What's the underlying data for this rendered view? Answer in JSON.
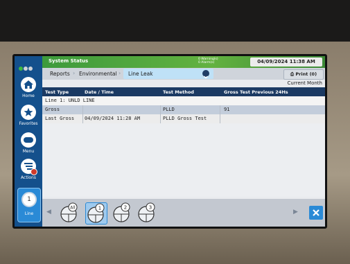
{
  "status_bar": {
    "title": "System Status",
    "warnings": "0 Warning(s)",
    "alarms": "0 Alarm(s)",
    "datetime": "04/09/2024 11:38 AM",
    "led_colors": [
      "#3fb83f",
      "#cfd3d8",
      "#cfd3d8"
    ]
  },
  "sidebar": {
    "items": [
      {
        "label": "Home",
        "icon": "home-icon"
      },
      {
        "label": "Favorites",
        "icon": "star-icon"
      },
      {
        "label": "Menu",
        "icon": "menu-icon"
      },
      {
        "label": "Actions",
        "icon": "actions-icon"
      }
    ],
    "tank_button": {
      "number": "1",
      "label": "Line"
    }
  },
  "breadcrumb": {
    "items": [
      "Reports",
      "Environmental",
      "Line Leak"
    ],
    "print_label": "Print (0)"
  },
  "period": "Current Month",
  "table": {
    "columns": [
      "Test Type",
      "Date / Time",
      "Test Method",
      "Gross Test Previous 24Hs"
    ],
    "group_label": "Line 1: UNLD LINE",
    "rows": [
      [
        "Gross",
        "",
        "PLLD",
        "91"
      ],
      [
        "Last Gross",
        "04/09/2024 11:28 AM",
        "PLLD Gross Test",
        ""
      ]
    ]
  },
  "bottom_bar": {
    "tank_buttons": [
      "All",
      "1",
      "2",
      "3"
    ],
    "selected": "1"
  },
  "colors": {
    "status_green": "#4ea83e",
    "header_navy": "#1b3a63",
    "accent_blue": "#2a8ad6",
    "sidebar_blue": "#14508c"
  }
}
